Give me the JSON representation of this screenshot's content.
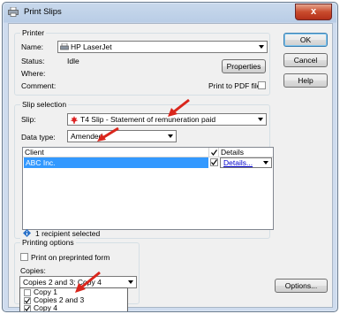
{
  "window": {
    "title": "Print Slips",
    "close_glyph": "x"
  },
  "printer": {
    "group_label": "Printer",
    "name_label": "Name:",
    "name_value": "HP LaserJet",
    "status_label": "Status:",
    "status_value": "Idle",
    "where_label": "Where:",
    "comment_label": "Comment:",
    "properties_button": "Properties",
    "print_to_pdf_label": "Print to PDF file"
  },
  "slip_selection": {
    "group_label": "Slip selection",
    "slip_label": "Slip:",
    "slip_value": "T4 Slip - Statement of remuneration paid",
    "data_type_label": "Data type:",
    "data_type_value": "Amended",
    "table": {
      "columns": [
        "Client",
        "",
        "Details"
      ],
      "rows": [
        {
          "client": "ABC Inc.",
          "checked": true,
          "details": "Details..."
        }
      ]
    },
    "recipient_status": "1 recipient selected"
  },
  "printing_options": {
    "group_label": "Printing options",
    "preprinted_label": "Print on preprinted form",
    "copies_label": "Copies:",
    "copies_value": "Copies 2 and 3; Copy 4",
    "copies_options": [
      {
        "label": "Copy 1",
        "checked": false
      },
      {
        "label": "Copies 2 and 3",
        "checked": true
      },
      {
        "label": "Copy 4",
        "checked": true
      }
    ]
  },
  "buttons": {
    "ok": "OK",
    "cancel": "Cancel",
    "help": "Help",
    "options": "Options..."
  },
  "colors": {
    "annotation_arrow": "#d9261c",
    "selection": "#3399ff",
    "link": "#0000cc"
  }
}
